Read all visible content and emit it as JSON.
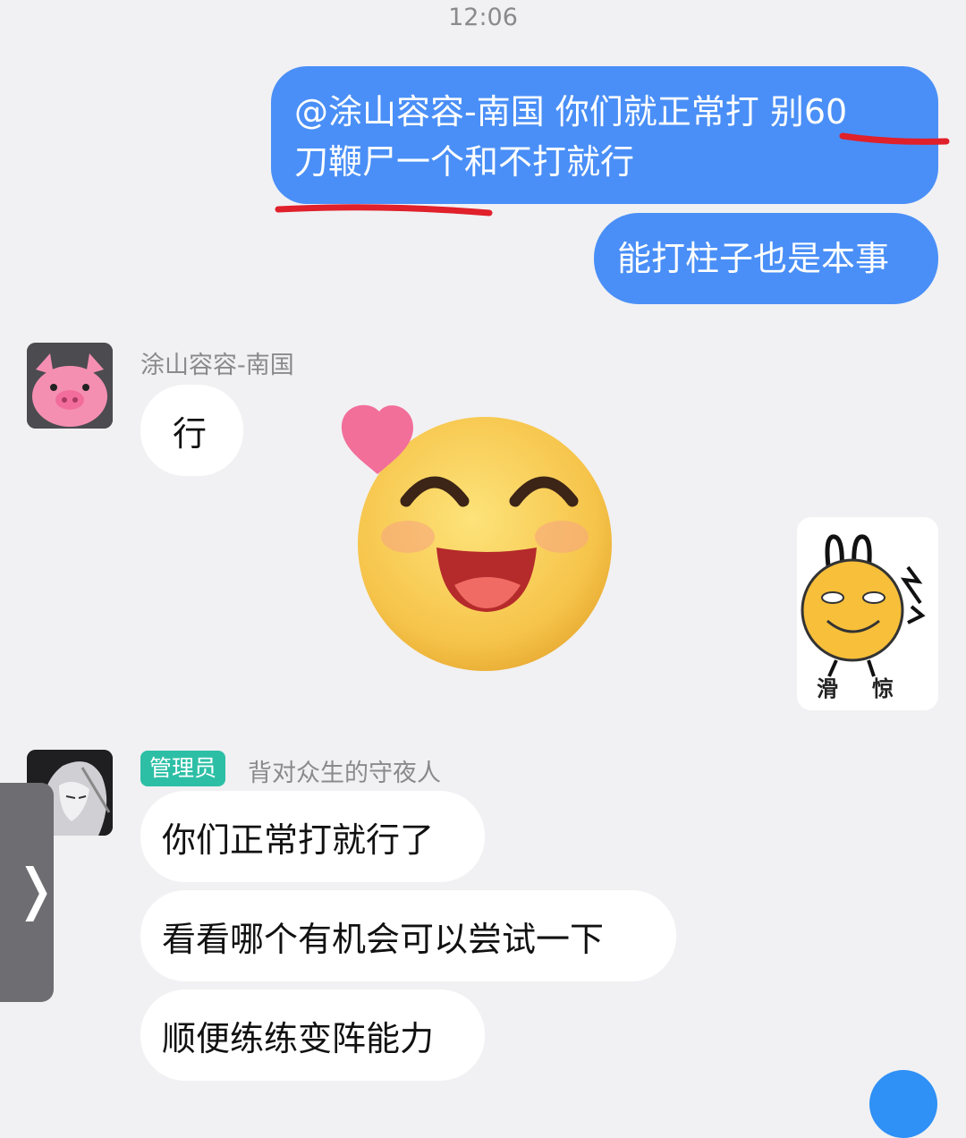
{
  "status": {
    "time": "12:06"
  },
  "messages_out": [
    {
      "line1": "@涂山容容-南国 你们就正常打 别60",
      "line2": "刀鞭尸一个和不打就行"
    },
    {
      "text": "能打柱子也是本事"
    }
  ],
  "user1": {
    "name": "涂山容容-南国",
    "avatar_icon": "pink-pig-avatar",
    "message": "行"
  },
  "emoji_big": {
    "icon": "smiling-face-with-heart-emoji"
  },
  "sticker": {
    "icon": "funny-face-sticker",
    "label_left": "滑",
    "label_right": "惊"
  },
  "user2": {
    "badge": "管理员",
    "name": "背对众生的守夜人",
    "avatar_icon": "anime-character-avatar",
    "messages": [
      "你们正常打就行了",
      "看看哪个有机会可以尝试一下",
      "顺便练练变阵能力"
    ]
  },
  "side_handle": {
    "icon": "chevron-right-icon",
    "glyph": "❭"
  },
  "colors": {
    "outgoing": "#4a8ff7",
    "incoming": "#ffffff",
    "background": "#f1f1f3",
    "annotation": "#e0202a",
    "admin": "#2dbfa6"
  }
}
